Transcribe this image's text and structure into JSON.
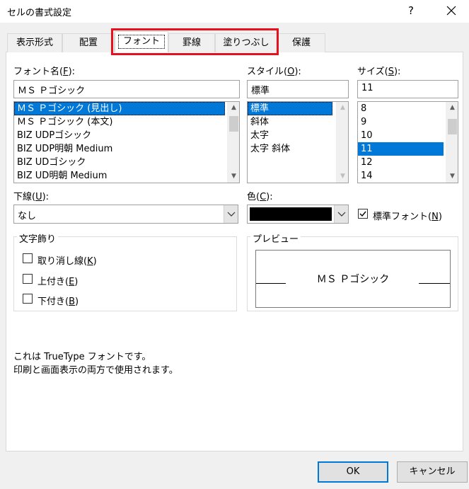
{
  "window": {
    "title": "セルの書式設定",
    "help_glyph": "?"
  },
  "tabs": [
    {
      "label": "表示形式"
    },
    {
      "label": "配置"
    },
    {
      "label": "フォント"
    },
    {
      "label": "罫線"
    },
    {
      "label": "塗りつぶし"
    },
    {
      "label": "保護"
    }
  ],
  "font": {
    "label_pre": "フォント名(",
    "label_key": "F",
    "label_post": "):",
    "value": "ＭＳ Ｐゴシック",
    "options": [
      "ＭＳ Ｐゴシック (見出し)",
      "ＭＳ Ｐゴシック (本文)",
      "BIZ UDPゴシック",
      "BIZ UDP明朝 Medium",
      "BIZ UDゴシック",
      "BIZ UD明朝 Medium"
    ]
  },
  "style": {
    "label_pre": "スタイル(",
    "label_key": "O",
    "label_post": "):",
    "value": "標準",
    "options": [
      "標準",
      "斜体",
      "太字",
      "太字 斜体"
    ]
  },
  "size": {
    "label_pre": "サイズ(",
    "label_key": "S",
    "label_post": "):",
    "value": "11",
    "options": [
      "8",
      "9",
      "10",
      "11",
      "12",
      "14"
    ]
  },
  "underline": {
    "label_pre": "下線(",
    "label_key": "U",
    "label_post": "):",
    "value": "なし"
  },
  "color": {
    "label_pre": "色(",
    "label_key": "C",
    "label_post": "):",
    "swatch": "#000000"
  },
  "normal_font": {
    "label_pre": "標準フォント(",
    "label_key": "N",
    "label_post": ")",
    "checked": true
  },
  "effects": {
    "title": "文字飾り",
    "items": [
      {
        "pre": "取り消し線(",
        "key": "K",
        "post": ")"
      },
      {
        "pre": "上付き(",
        "key": "E",
        "post": ")"
      },
      {
        "pre": "下付き(",
        "key": "B",
        "post": ")"
      }
    ]
  },
  "preview": {
    "title": "プレビュー",
    "text": "ＭＳ Ｐゴシック"
  },
  "info": {
    "line1": "これは TrueType フォントです。",
    "line2": "印刷と画面表示の両方で使用されます。"
  },
  "buttons": {
    "ok": "OK",
    "cancel": "キャンセル"
  },
  "colors": {
    "selection": "#0078d7",
    "highlight": "#e8101f"
  }
}
